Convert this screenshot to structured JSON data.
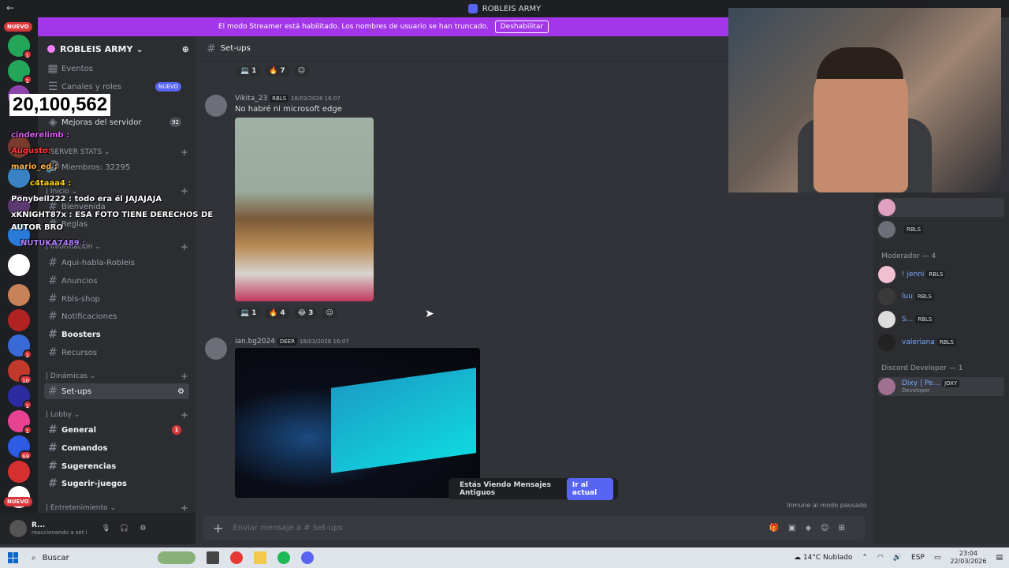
{
  "window": {
    "title": "ROBLEIS ARMY"
  },
  "banner": {
    "text": "El modo Streamer está habilitado. Los nombres de usuario se han truncado.",
    "button": "Deshabilitar"
  },
  "servers": {
    "new_label_top": "NUEVO",
    "new_label_bottom": "NUEVO",
    "badges": [
      "1",
      "1",
      "1",
      "1",
      "1",
      "1",
      "1",
      "1",
      "1",
      "1",
      "69",
      "1",
      "10",
      "1",
      "1",
      "1"
    ]
  },
  "server": {
    "name": "ROBLEIS ARMY",
    "events": "Eventos",
    "roles": "Canales y roles",
    "roles_badge": "NUEVO",
    "improve": "Mejoras del servidor",
    "improve_count": "92",
    "stats_cat": "SERVER STATS",
    "members": "Miembros: 32295"
  },
  "overlay": {
    "counter": "20,100,562",
    "lines": [
      "cinderelimb :",
      "Augusto:",
      "mario_ed :",
      "c4taaa4 :",
      "Ponybell222 : todo era él JAJAJAJA",
      "xKNIGHT87x : ESA FOTO TIENE DERECHOS DE",
      "AUTOR BRO",
      "NUTUKA7489 :"
    ]
  },
  "channels": {
    "cat_inicio": "| Inicio",
    "bienvenida": "Bienvenida",
    "reglas": "Reglas",
    "cat_info": "| Información",
    "items": [
      "Aqui-habla-Robleis",
      "Anuncios",
      "Rbls-shop",
      "Notificaciones",
      "Boosters",
      "Recursos"
    ],
    "cat_dinamicas": "| Dinámicas",
    "setups": "Set-ups",
    "cat_lobby": "| Lobby",
    "general": "General",
    "general_badge": "1",
    "comandos": "Comandos",
    "sugerencias": "Sugerencias",
    "sugerir": "Sugerir-juegos",
    "cat_entretenimiento": "| Entretenimiento"
  },
  "user": {
    "name": "R...",
    "status": "reaccionando a set i"
  },
  "chat": {
    "channel": "Set-ups",
    "react1": [
      "1",
      "7"
    ],
    "msg1": {
      "author": "Vikita_23",
      "tag": "RBLS",
      "time": "18/03/2026 16:07",
      "text": "No habré ni microsoft edge"
    },
    "react2": [
      "1",
      "4",
      "3"
    ],
    "msg2": {
      "author": "ian.bg2024",
      "tag": "DEER",
      "time": "18/03/2026 16:07"
    },
    "old_msgs": "Estás Viendo Mensajes Antiguos",
    "go_now": "Ir al actual",
    "composer_placeholder": "Enviar mensaje a # Set-ups",
    "paused": "Inmune al modo pausado"
  },
  "members": {
    "moderador": "Moderador — 4",
    "discord_dev": "Discord Developer — 1",
    "rows": [
      {
        "name": "",
        "tag": ""
      },
      {
        "name": "",
        "tag": "RBLS"
      },
      {
        "name": "! jenni",
        "tag": "RBLS"
      },
      {
        "name": "luu",
        "tag": "RBLS"
      },
      {
        "name": "S...",
        "tag": "RBLS"
      },
      {
        "name": "valeriana",
        "tag": "RBLS"
      },
      {
        "name": "Dixy | Pe...",
        "tag": "JOXY",
        "sub": "Developer"
      }
    ]
  },
  "taskbar": {
    "search": "Buscar",
    "weather": "14°C  Nublado",
    "lang": "ESP",
    "time": "23:04",
    "date": "22/03/2026"
  }
}
